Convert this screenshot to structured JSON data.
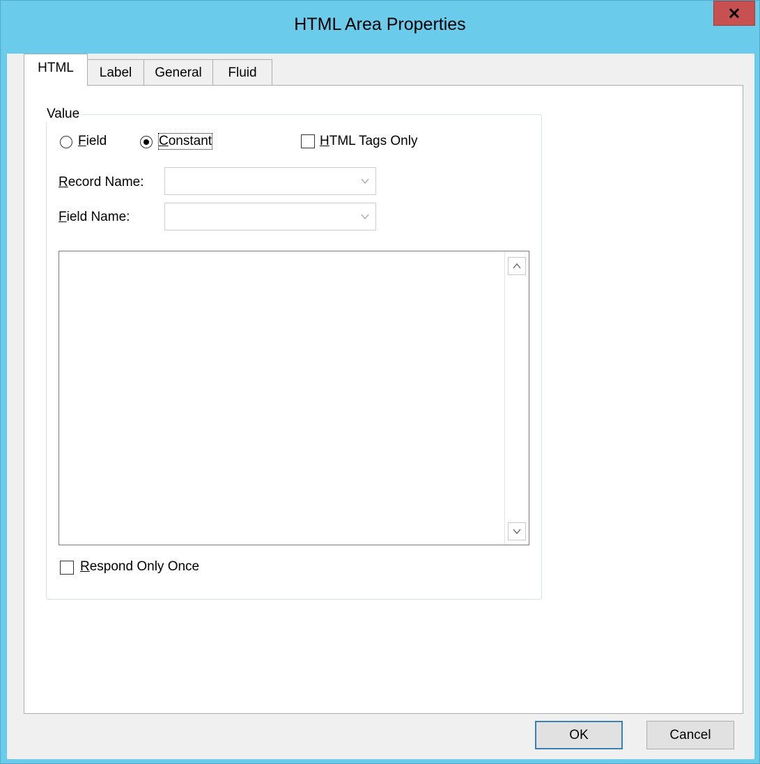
{
  "window": {
    "title": "HTML Area Properties",
    "close_glyph": "✕"
  },
  "tabs": [
    {
      "label": "HTML",
      "active": true
    },
    {
      "label": "Label",
      "active": false
    },
    {
      "label": "General",
      "active": false
    },
    {
      "label": "Fluid",
      "active": false
    }
  ],
  "value_group": {
    "legend": "Value",
    "radio_field": {
      "label": "Field",
      "mnemonic": "F",
      "rest": "ield",
      "checked": false
    },
    "radio_constant": {
      "label": "Constant",
      "mnemonic": "C",
      "rest": "onstant",
      "checked": true
    },
    "html_tags_only": {
      "label": "HTML Tags Only",
      "mnemonic": "H",
      "rest": "TML Tags Only",
      "checked": false
    },
    "record_name": {
      "label": "Record Name:",
      "mnemonic": "R",
      "rest": "ecord Name:",
      "value": ""
    },
    "field_name": {
      "label": "Field Name:",
      "mnemonic": "F",
      "rest": "ield Name:",
      "value": ""
    },
    "constant_text": "",
    "respond_only_once": {
      "label": "Respond Only Once",
      "mnemonic": "R",
      "rest": "espond Only Once",
      "checked": false
    }
  },
  "buttons": {
    "ok": "OK",
    "cancel": "Cancel"
  },
  "colors": {
    "titlebar": "#6acbea",
    "close_button": "#c75050",
    "dialog_bg": "#f0f0f0"
  }
}
